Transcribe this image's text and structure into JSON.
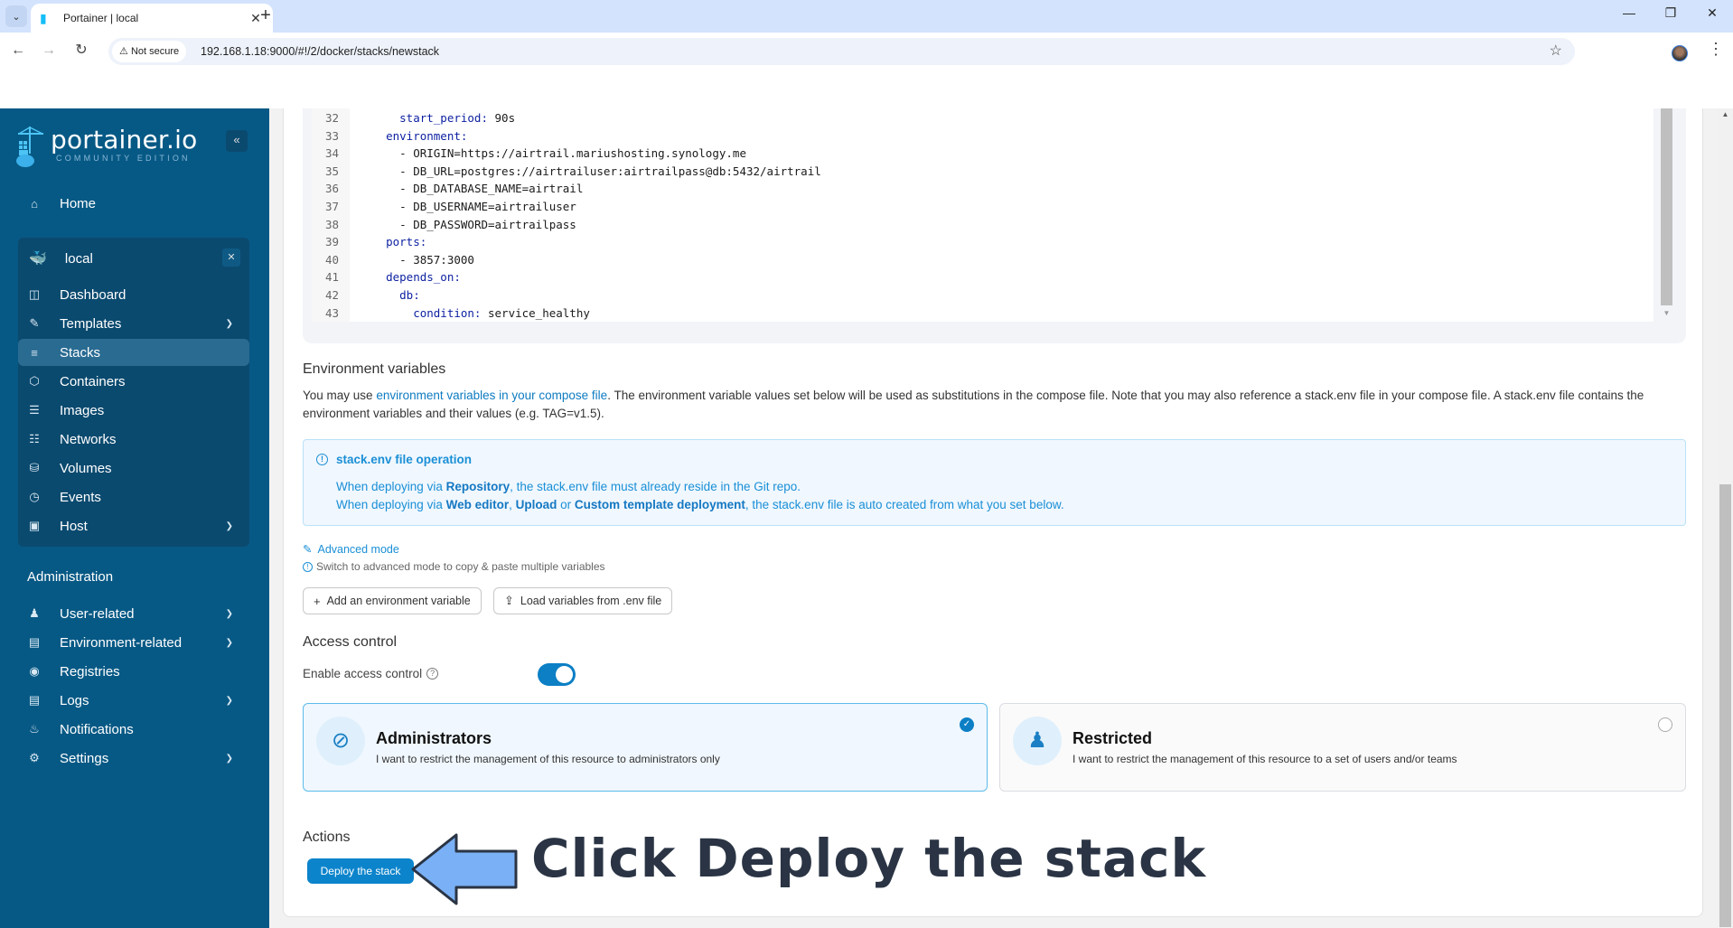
{
  "browser": {
    "tab_title": "Portainer | local",
    "not_secure_label": "Not secure",
    "url": "192.168.1.18:9000/#!/2/docker/stacks/newstack"
  },
  "sidebar": {
    "logo_name": "portainer.io",
    "logo_sub": "COMMUNITY EDITION",
    "home": "Home",
    "environment": {
      "name": "local",
      "items": [
        {
          "label": "Dashboard",
          "icon": "dashboard-icon",
          "expandable": false
        },
        {
          "label": "Templates",
          "icon": "edit-icon",
          "expandable": true
        },
        {
          "label": "Stacks",
          "icon": "layers-icon",
          "expandable": false,
          "active": true
        },
        {
          "label": "Containers",
          "icon": "box-icon",
          "expandable": false
        },
        {
          "label": "Images",
          "icon": "list-icon",
          "expandable": false
        },
        {
          "label": "Networks",
          "icon": "network-icon",
          "expandable": false
        },
        {
          "label": "Volumes",
          "icon": "database-icon",
          "expandable": false
        },
        {
          "label": "Events",
          "icon": "clock-icon",
          "expandable": false
        },
        {
          "label": "Host",
          "icon": "host-icon",
          "expandable": true
        }
      ]
    },
    "administration_heading": "Administration",
    "admin_items": [
      {
        "label": "User-related",
        "icon": "users-icon",
        "expandable": true
      },
      {
        "label": "Environment-related",
        "icon": "drive-icon",
        "expandable": true
      },
      {
        "label": "Registries",
        "icon": "radio-icon",
        "expandable": false
      },
      {
        "label": "Logs",
        "icon": "file-icon",
        "expandable": true
      },
      {
        "label": "Notifications",
        "icon": "bell-icon",
        "expandable": false
      },
      {
        "label": "Settings",
        "icon": "gear-icon",
        "expandable": true
      }
    ]
  },
  "editor": {
    "lines": [
      {
        "n": "32",
        "indent": "      ",
        "key": "start_period",
        "sep": ": ",
        "val": "90s"
      },
      {
        "n": "33",
        "indent": "    ",
        "key": "environment",
        "sep": ":",
        "val": ""
      },
      {
        "n": "34",
        "indent": "      ",
        "key": "",
        "sep": "",
        "val": "- ORIGIN=https://airtrail.mariushosting.synology.me"
      },
      {
        "n": "35",
        "indent": "      ",
        "key": "",
        "sep": "",
        "val": "- DB_URL=postgres://airtrailuser:airtrailpass@db:5432/airtrail"
      },
      {
        "n": "36",
        "indent": "      ",
        "key": "",
        "sep": "",
        "val": "- DB_DATABASE_NAME=airtrail"
      },
      {
        "n": "37",
        "indent": "      ",
        "key": "",
        "sep": "",
        "val": "- DB_USERNAME=airtrailuser"
      },
      {
        "n": "38",
        "indent": "      ",
        "key": "",
        "sep": "",
        "val": "- DB_PASSWORD=airtrailpass"
      },
      {
        "n": "39",
        "indent": "    ",
        "key": "ports",
        "sep": ":",
        "val": ""
      },
      {
        "n": "40",
        "indent": "      ",
        "key": "",
        "sep": "",
        "val": "- 3857:3000"
      },
      {
        "n": "41",
        "indent": "    ",
        "key": "depends_on",
        "sep": ":",
        "val": ""
      },
      {
        "n": "42",
        "indent": "      ",
        "key": "db",
        "sep": ":",
        "val": ""
      },
      {
        "n": "43",
        "indent": "        ",
        "key": "condition",
        "sep": ": ",
        "val": "service_healthy"
      }
    ]
  },
  "env_vars": {
    "title": "Environment variables",
    "desc_prefix": "You may use ",
    "desc_link": "environment variables in your compose file",
    "desc_suffix": ". The environment variable values set below will be used as substitutions in the compose file. Note that you may also reference a stack.env file in your compose file. A stack.env file contains the environment variables and their values (e.g. TAG=v1.5).",
    "info_title": "stack.env file operation",
    "info_line1": {
      "a": "When deploying via ",
      "b1": "Repository",
      "c": ", the stack.env file must already reside in the Git repo."
    },
    "info_line2": {
      "a": "When deploying via ",
      "b1": "Web editor",
      "s1": ", ",
      "b2": "Upload",
      "s2": " or ",
      "b3": "Custom template deployment",
      "c": ", the stack.env file is auto created from what you set below."
    },
    "advanced_mode": "Advanced mode",
    "advanced_hint": "Switch to advanced mode to copy & paste multiple variables",
    "add_button": "Add an environment variable",
    "load_button": "Load variables from .env file"
  },
  "access_control": {
    "title": "Access control",
    "enable_label": "Enable access control",
    "enabled": true,
    "options": [
      {
        "title": "Administrators",
        "desc": "I want to restrict the management of this resource to administrators only",
        "selected": true
      },
      {
        "title": "Restricted",
        "desc": "I want to restrict the management of this resource to a set of users and/or teams",
        "selected": false
      }
    ]
  },
  "actions": {
    "title": "Actions",
    "deploy_button": "Deploy the stack"
  },
  "annotation": {
    "text": "Click Deploy the stack"
  },
  "colors": {
    "sidebar_bg": "#075985",
    "accent": "#0c7fc5",
    "annotation_arrow": "#7ab0f5"
  }
}
